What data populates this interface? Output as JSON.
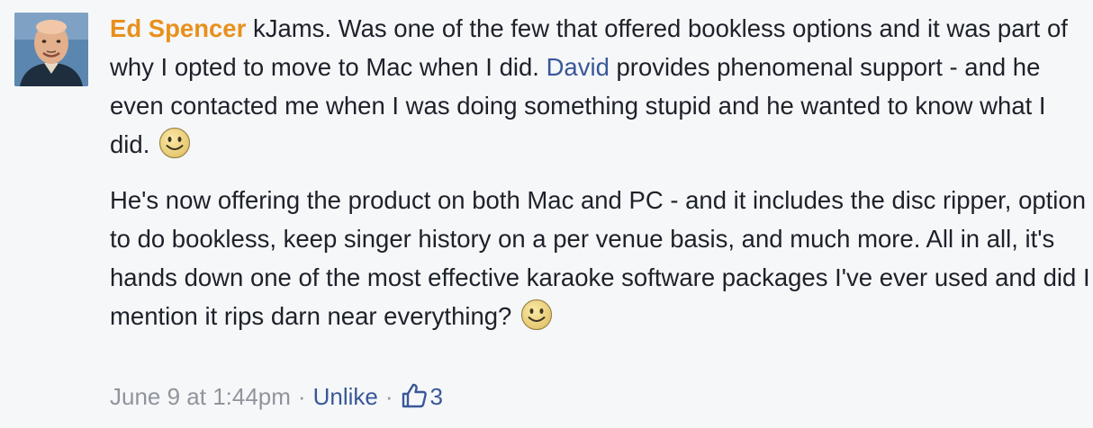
{
  "comment": {
    "author": "Ed Spencer",
    "paragraph1_a": " kJams. Was one of the few that offered bookless options and it was part of why I opted to move to Mac when I did. ",
    "mention": "David",
    "paragraph1_b": " provides phenomenal support - and he even contacted me when I was doing something stupid and he wanted to know what I did. ",
    "paragraph2": "He's now offering the product on both Mac and PC - and it includes the disc ripper, option to do bookless, keep singer history on a per venue basis, and much more. All in all, it's hands down one of the most effective karaoke software packages I've ever used and did I mention it rips darn near everything? ",
    "emoji_1": "smile-emoji",
    "emoji_2": "smile-emoji"
  },
  "meta": {
    "timestamp": "June 9 at 1:44pm",
    "separator": "·",
    "unlike_label": "Unlike",
    "like_icon": "thumbs-up-icon",
    "like_count": "3"
  },
  "colors": {
    "author": "#e8901c",
    "link": "#385898",
    "meta": "#90949c",
    "background": "#f6f7f9"
  }
}
